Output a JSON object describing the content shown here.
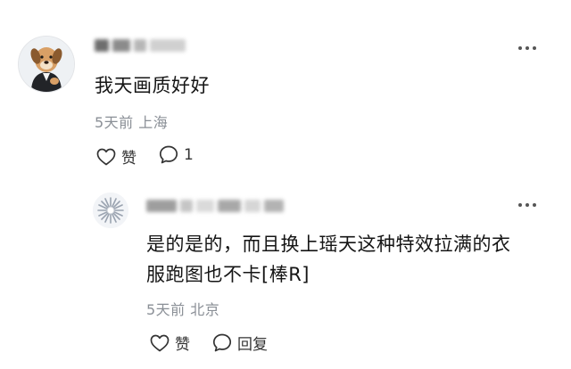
{
  "comment": {
    "text": "我天画质好好",
    "meta": "5天前 上海",
    "like_label": "赞",
    "reply_count": "1"
  },
  "reply": {
    "text_line1": "是的是的，而且换上瑶天这种特效拉满的衣",
    "text_line2": "服跑图也不卡[棒R]",
    "meta": "5天前 北京",
    "like_label": "赞",
    "reply_label": "回复"
  }
}
